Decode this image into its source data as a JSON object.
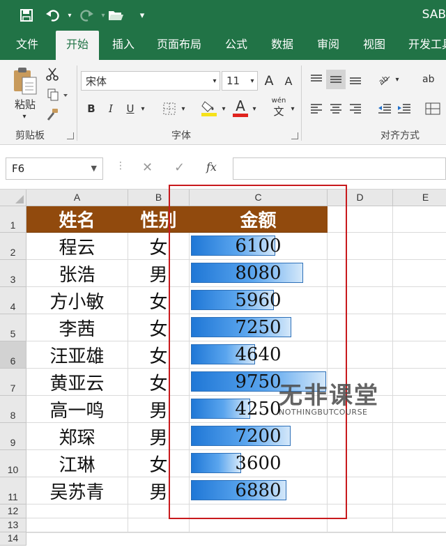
{
  "titlebar": {
    "title": "SAB"
  },
  "tabs": [
    "文件",
    "开始",
    "插入",
    "页面布局",
    "公式",
    "数据",
    "审阅",
    "视图",
    "开发工具"
  ],
  "ribbon": {
    "paste_label": "粘贴",
    "font_name": "宋体",
    "font_size": "11",
    "grow_font": "A",
    "shrink_font": "A",
    "bold": "B",
    "italic": "I",
    "underline": "U",
    "font_color_glyph": "A",
    "phonetic_glyph": "wén",
    "phonetic_sub": "文",
    "wrap_glyph": "ab",
    "groups": {
      "clipboard": "剪贴板",
      "font": "字体",
      "alignment": "对齐方式"
    }
  },
  "formula_bar": {
    "name_box": "F6",
    "fx": "fx",
    "formula": ""
  },
  "sheet": {
    "columns": [
      "A",
      "B",
      "C",
      "D",
      "E"
    ],
    "rows": [
      "1",
      "2",
      "3",
      "4",
      "5",
      "6",
      "7",
      "8",
      "9",
      "10",
      "11",
      "12",
      "13",
      "14"
    ],
    "selected_row": "6",
    "headers": [
      "姓名",
      "性别",
      "金额"
    ],
    "records": [
      {
        "name": "程云",
        "gender": "女",
        "amount": "6100"
      },
      {
        "name": "张浩",
        "gender": "男",
        "amount": "8080"
      },
      {
        "name": "方小敏",
        "gender": "女",
        "amount": "5960"
      },
      {
        "name": "李茜",
        "gender": "女",
        "amount": "7250"
      },
      {
        "name": "汪亚雄",
        "gender": "女",
        "amount": "4640"
      },
      {
        "name": "黄亚云",
        "gender": "女",
        "amount": "9750"
      },
      {
        "name": "高一鸣",
        "gender": "男",
        "amount": "4250"
      },
      {
        "name": "郑琛",
        "gender": "男",
        "amount": "7200"
      },
      {
        "name": "江琳",
        "gender": "女",
        "amount": "3600"
      },
      {
        "name": "吴苏青",
        "gender": "男",
        "amount": "6880"
      }
    ],
    "bar_max": 9750,
    "header_color": "#914a0d",
    "bar_color": "#1f77d6",
    "highlight_color": "#c8191c"
  },
  "watermark": {
    "main": "无非课堂",
    "sub": "NOTHINGBUTCOURSE"
  },
  "icons": [
    "save-icon",
    "undo-icon",
    "redo-icon",
    "open-folder-icon",
    "customize-icon",
    "paste-icon",
    "cut-icon",
    "copy-icon",
    "format-painter-icon",
    "borders-icon",
    "fill-color-icon",
    "align-top-icon",
    "align-middle-icon",
    "align-bottom-icon",
    "orientation-icon",
    "align-left-icon",
    "align-center-icon",
    "align-right-icon",
    "decrease-indent-icon",
    "increase-indent-icon",
    "merge-icon",
    "cancel-icon",
    "enter-icon"
  ]
}
